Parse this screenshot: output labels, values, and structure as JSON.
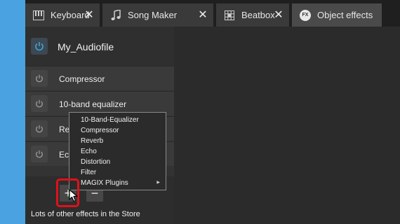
{
  "tabs": [
    {
      "label": "Keyboard",
      "icon": "keyboard-icon",
      "active": false
    },
    {
      "label": "Song Maker",
      "icon": "music-note-icon",
      "active": false
    },
    {
      "label": "Beatbox",
      "icon": "grid-icon",
      "active": false
    },
    {
      "label": "Object effects",
      "icon": "fx-icon",
      "icon_text": "FX",
      "active": true
    }
  ],
  "tab_close_glyph": "✕",
  "panel": {
    "title": "My_Audiofile",
    "effects": [
      {
        "label": "Compressor"
      },
      {
        "label": "10-band equalizer"
      },
      {
        "label": "Rev"
      },
      {
        "label": "Ech"
      }
    ],
    "add_label": "+",
    "remove_label": "−",
    "store_text": "Lots of other effects in the Store"
  },
  "context_menu": {
    "items": [
      {
        "label": "10-Band-Equalizer"
      },
      {
        "label": "Compressor"
      },
      {
        "label": "Reverb"
      },
      {
        "label": "Echo"
      },
      {
        "label": "Distortion"
      },
      {
        "label": "Filter"
      },
      {
        "label": "MAGIX Plugins",
        "has_submenu": true
      }
    ]
  },
  "colors": {
    "background": "#4aa3e0",
    "power_accent": "#3fa3dc",
    "highlight": "#e0111b"
  }
}
